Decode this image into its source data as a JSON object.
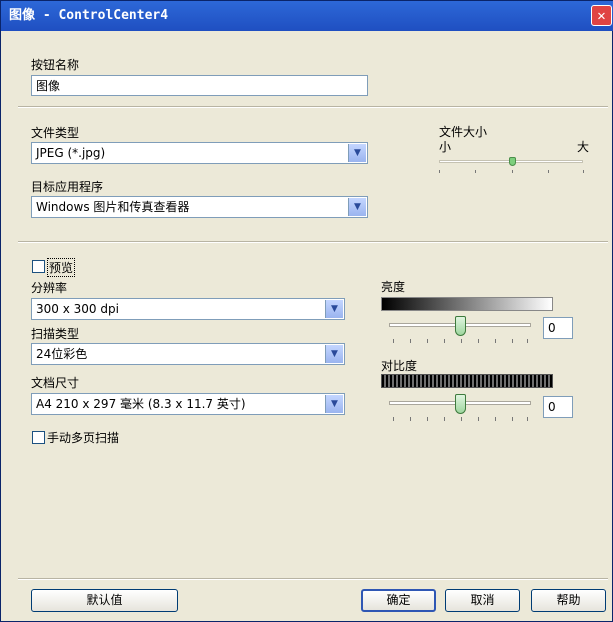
{
  "window": {
    "title": "图像 - ControlCenter4",
    "close_glyph": "✕"
  },
  "button_name": {
    "label": "按钮名称",
    "value": "图像"
  },
  "file_type": {
    "label": "文件类型",
    "value": "JPEG (*.jpg)"
  },
  "file_size": {
    "label": "文件大小",
    "min_label": "小",
    "max_label": "大",
    "level_fraction": 0.6
  },
  "target_app": {
    "label": "目标应用程序",
    "value": "Windows 图片和传真查看器"
  },
  "preview": {
    "label": "预览",
    "checked": false
  },
  "resolution": {
    "label": "分辨率",
    "value": "300 x 300 dpi"
  },
  "scan_type": {
    "label": "扫描类型",
    "value": "24位彩色"
  },
  "document_size": {
    "label": "文档尺寸",
    "value": "A4 210 x 297 毫米 (8.3 x 11.7 英寸)"
  },
  "brightness": {
    "label": "亮度",
    "value": "0"
  },
  "contrast": {
    "label": "对比度",
    "value": "0"
  },
  "manual_multipage": {
    "label": "手动多页扫描",
    "checked": false
  },
  "buttons": {
    "default": "默认值",
    "ok": "确定",
    "cancel": "取消",
    "help": "帮助"
  },
  "icons": {
    "dropdown": "chevron-down-icon",
    "close": "close-icon"
  },
  "colors": {
    "title_bar": "#2d68d8",
    "window_background": "#ece9d8",
    "slider_thumb": "#9ed69e"
  }
}
